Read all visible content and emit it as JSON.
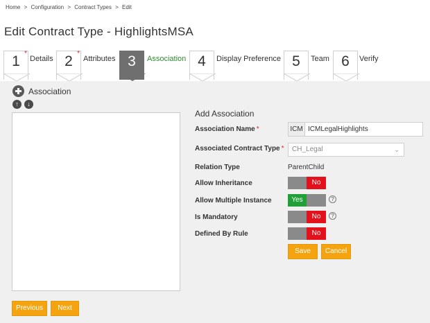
{
  "breadcrumb": [
    "Home",
    ">",
    "Configuration",
    ">",
    "Contract Types",
    ">",
    "Edit"
  ],
  "page_title": "Edit Contract Type - HighlightsMSA",
  "steps": [
    {
      "num": "1",
      "label": "Details",
      "required": "*"
    },
    {
      "num": "2",
      "label": "Attributes",
      "required": "*"
    },
    {
      "num": "3",
      "label": "Association",
      "required": ""
    },
    {
      "num": "4",
      "label": "Display Preference",
      "required": ""
    },
    {
      "num": "5",
      "label": "Team",
      "required": ""
    },
    {
      "num": "6",
      "label": "Verify",
      "required": ""
    }
  ],
  "active_step": "3",
  "association_panel": {
    "title": "Association",
    "plus_icon": "plus-circle-icon",
    "up_icon": "arrow-up-circle-icon",
    "down_icon": "arrow-down-circle-icon"
  },
  "form": {
    "title": "Add Association",
    "association_name": {
      "label": "Association Name",
      "required": "*",
      "prefix": "ICM",
      "value": "ICMLegalHighlights"
    },
    "associated_contract_type": {
      "label": "Associated Contract Type",
      "required": "*",
      "value": "CH_Legal"
    },
    "relation_type": {
      "label": "Relation Type",
      "value": "ParentChild"
    },
    "allow_inheritance": {
      "label": "Allow Inheritance",
      "state": "No"
    },
    "allow_multiple_instance": {
      "label": "Allow Multiple Instance",
      "state": "Yes",
      "help": "?"
    },
    "is_mandatory": {
      "label": "Is Mandatory",
      "state": "No",
      "help": "?"
    },
    "defined_by_rule": {
      "label": "Defined By Rule",
      "state": "No"
    },
    "save_label": "Save",
    "cancel_label": "Cancel"
  },
  "footer": {
    "previous_label": "Previous",
    "next_label": "Next"
  },
  "colors": {
    "accent_orange": "#f5a410",
    "no_red": "#e2111c",
    "yes_green": "#22a038",
    "active_step_bg": "#6f6f6f",
    "active_step_text": "#2e8b2e"
  }
}
